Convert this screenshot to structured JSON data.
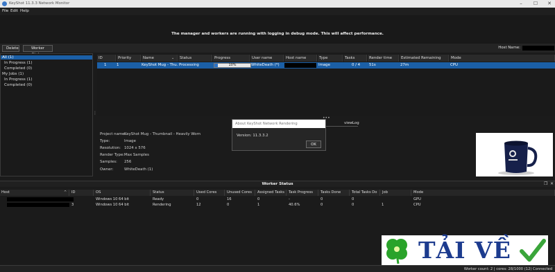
{
  "window": {
    "title": "KeyShot 11.3.3 Network Monitor",
    "controls": [
      "–",
      "☐",
      "✕"
    ]
  },
  "menu": [
    "File",
    "Edit",
    "Help"
  ],
  "banner": {
    "message": "The manager and workers are running with logging in debug mode. This will affect performance."
  },
  "toolbar": {
    "delete_label": "Delete",
    "worker_status_label": "Worker Status",
    "host_name_label": "Host Name:"
  },
  "job_filters": [
    {
      "label": "All (1)",
      "selected": true
    },
    {
      "label": "In Progress (1)",
      "selected": false
    },
    {
      "label": "Completed (0)",
      "selected": false
    },
    {
      "label": "My Jobs (1)",
      "selected": false
    },
    {
      "label": "In Progress (1)",
      "selected": false
    },
    {
      "label": "Completed (0)",
      "selected": false
    }
  ],
  "jobs": {
    "columns": [
      "ID",
      "Priority",
      "Name",
      "Status",
      "Progress",
      "User name",
      "Host name",
      "Type",
      "Tasks",
      "Render time",
      "Estimated Remaining tim",
      "Mode"
    ],
    "rows": [
      {
        "id": "1",
        "priority": "1",
        "name": "KeyShot Mug - Thu...",
        "status": "Processing",
        "progress_text": "10%",
        "progress": 0.1,
        "user": "WhiteDeath (*)",
        "type": "Image",
        "tasks": "0 / 4",
        "render_time": "51s",
        "remaining": "27m",
        "mode": "CPU"
      }
    ]
  },
  "details": {
    "project_name_label": "Project name:",
    "project_name": "KeyShot Mug - Thumbnail - Heavily Worn",
    "type_label": "Type:",
    "type": "Image",
    "resolution_label": "Resolution:",
    "resolution": "1024 x 576",
    "render_type_label": "Render Type:",
    "render_type": "Max Samples",
    "samples_label": "Samples:",
    "samples": "256",
    "owner_label": "Owner:",
    "owner": "WhiteDeath (1)"
  },
  "detail_tabs": [
    "view",
    "Log"
  ],
  "about_dialog": {
    "title": "About KeyShot Network Rendering",
    "version": "Version: 11.3.3.2",
    "ok_label": "OK"
  },
  "worker_status": {
    "title": "Worker Status",
    "columns": [
      "Host",
      "ID",
      "OS",
      "Status",
      "Used Cores",
      "Unused Cores",
      "Assigned Tasks",
      "Task Progress",
      "Tasks Done",
      "Total Tasks Do",
      "Job",
      "Mode"
    ],
    "rows": [
      {
        "id": "",
        "os": "Windows 10 64 bit",
        "status": "Ready",
        "used": "0",
        "unused": "16",
        "assigned": "0",
        "progress": "-",
        "done": "0",
        "total": "0",
        "job": "",
        "mode": "GPU"
      },
      {
        "id": "3",
        "os": "Windows 10 64 bit",
        "status": "Rendering",
        "used": "12",
        "unused": "0",
        "assigned": "1",
        "progress": "40.6%",
        "done": "0",
        "total": "0",
        "job": "1",
        "mode": "CPU"
      }
    ]
  },
  "statusbar": {
    "text": "Worker count: 2 | cores: 28/1000 (12) Connected"
  },
  "watermark": {
    "text": "TẢI VỀ"
  },
  "colors": {
    "selection": "#1b5fa6",
    "progress": "#2a72c8",
    "background": "#1b1b1b"
  }
}
